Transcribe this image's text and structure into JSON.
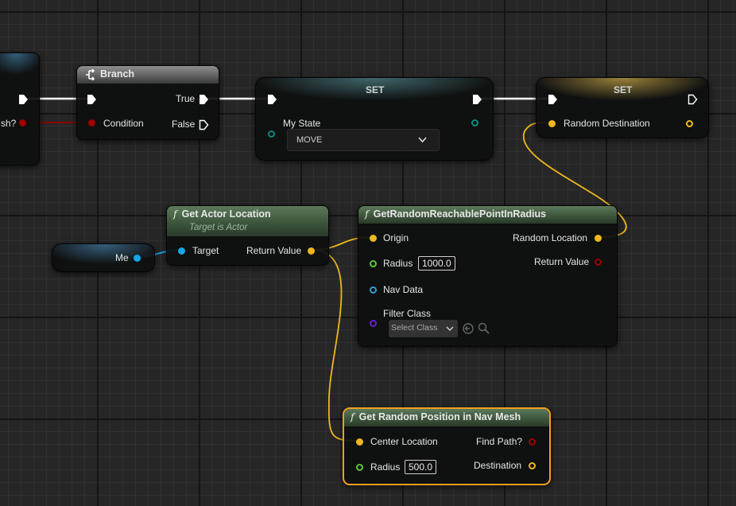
{
  "colors": {
    "exec": "#ffffff",
    "bool": "#a00000",
    "vector": "#f0b81c",
    "float": "#57c93a",
    "object": "#13a6e8",
    "enum": "#0b8a7c",
    "class": "#6a1ed8",
    "selected_outline": "#f0a020"
  },
  "partial_node": {
    "pin_label": "sh?"
  },
  "branch": {
    "title": "Branch",
    "pins": {
      "condition": "Condition",
      "true": "True",
      "false": "False"
    }
  },
  "set_state": {
    "title": "SET",
    "var_label": "My State",
    "value": "MOVE"
  },
  "set_destination": {
    "title": "SET",
    "var_label": "Random Destination"
  },
  "me_node": {
    "label": "Me"
  },
  "get_actor_location": {
    "title": "Get Actor Location",
    "subtitle": "Target is Actor",
    "pins": {
      "target": "Target",
      "return": "Return Value"
    }
  },
  "get_random_point": {
    "title": "GetRandomReachablePointInRadius",
    "pins": {
      "origin": "Origin",
      "radius": "Radius",
      "radius_value": "1000.0",
      "nav_data": "Nav Data",
      "filter_class": "Filter Class",
      "select_class": "Select Class",
      "random_location": "Random Location",
      "return": "Return Value"
    }
  },
  "get_random_position": {
    "title": "Get Random Position in Nav Mesh",
    "pins": {
      "center": "Center Location",
      "radius": "Radius",
      "radius_value": "500.0",
      "find_path": "Find Path?",
      "destination": "Destination"
    }
  }
}
